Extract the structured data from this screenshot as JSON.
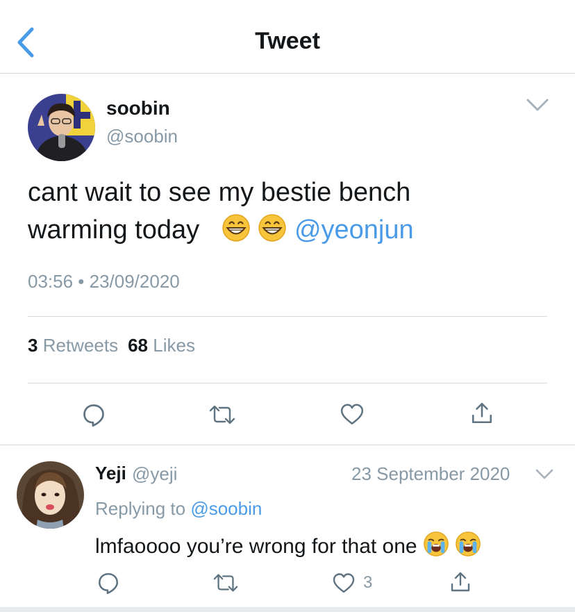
{
  "header": {
    "title": "Tweet",
    "back_icon": "chevron-left-icon"
  },
  "colors": {
    "accent": "#4a9be7",
    "secondary_text": "#8899a6",
    "primary_text": "#14171a",
    "divider": "#d6d9dc"
  },
  "tweet": {
    "author_name": "soobin",
    "author_handle": "@soobin",
    "text_line1": "cant wait to see my bestie bench",
    "text_line2": "warming today",
    "emojis": [
      "grinning-face-emoji",
      "grinning-face-emoji"
    ],
    "mention": "@yeonjun",
    "timestamp": "03:56 • 23/09/2020",
    "retweet_count": "3",
    "retweet_label": "Retweets",
    "like_count": "68",
    "like_label": "Likes",
    "actions": [
      "reply-icon",
      "retweet-icon",
      "like-icon",
      "share-icon"
    ]
  },
  "reply": {
    "author_name": "Yeji",
    "author_handle": "@yeji",
    "date": "23 September 2020",
    "replying_label": "Replying to",
    "replying_to": "@soobin",
    "text": "lmfaoooo you’re wrong for that one",
    "emojis": [
      "loudly-crying-face-emoji",
      "loudly-crying-face-emoji"
    ],
    "like_count": "3",
    "actions": [
      "reply-icon",
      "retweet-icon",
      "like-icon",
      "share-icon"
    ]
  }
}
